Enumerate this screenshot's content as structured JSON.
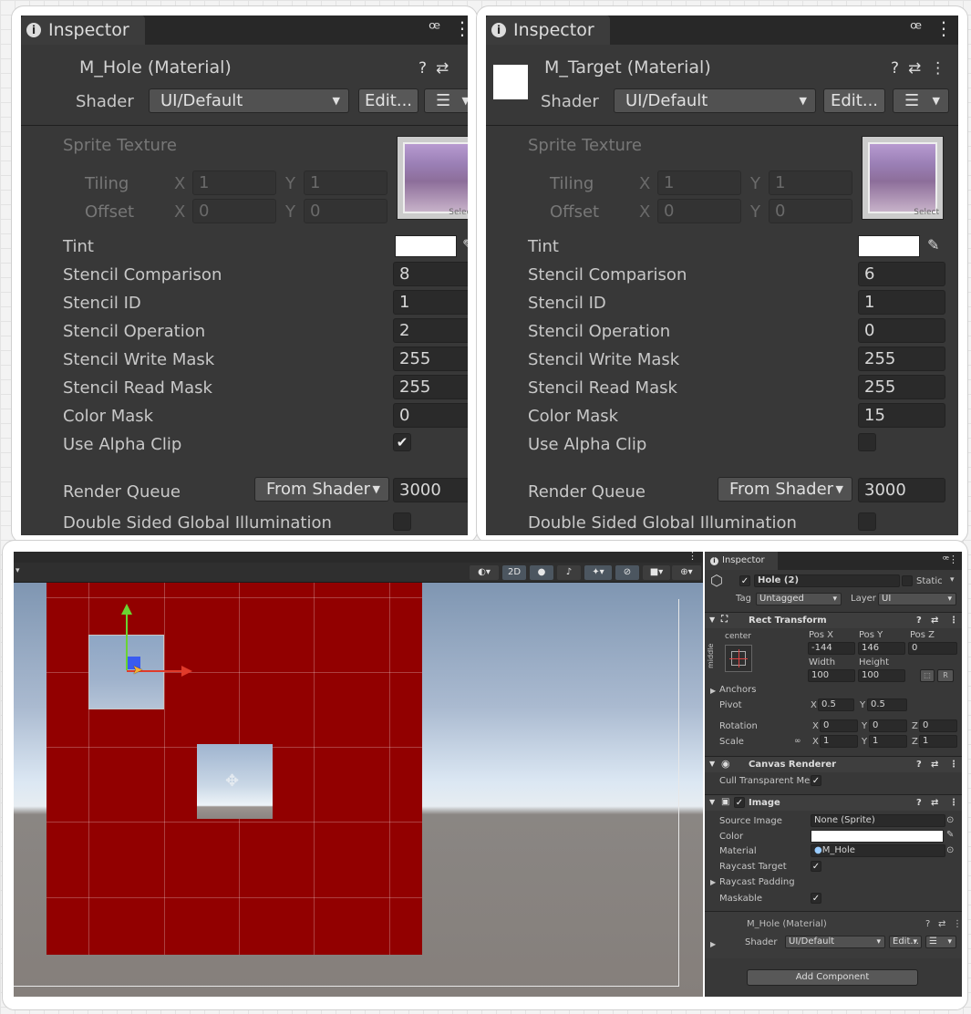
{
  "left_inspector": {
    "tab_title": "Inspector",
    "material_name": "M_Hole (Material)",
    "shader_label": "Shader",
    "shader_value": "UI/Default",
    "edit_label": "Edit...",
    "sprite_texture_label": "Sprite Texture",
    "tiling_label": "Tiling",
    "offset_label": "Offset",
    "x_label": "X",
    "y_label": "Y",
    "tiling_x": "1",
    "tiling_y": "1",
    "offset_x": "0",
    "offset_y": "0",
    "thumb_caption": "Select",
    "tint_label": "Tint",
    "tint_color": "#ffffff",
    "props": [
      {
        "label": "Stencil Comparison",
        "value": "8"
      },
      {
        "label": "Stencil ID",
        "value": "1"
      },
      {
        "label": "Stencil Operation",
        "value": "2"
      },
      {
        "label": "Stencil Write Mask",
        "value": "255"
      },
      {
        "label": "Stencil Read Mask",
        "value": "255"
      },
      {
        "label": "Color Mask",
        "value": "0"
      }
    ],
    "alpha_clip_label": "Use Alpha Clip",
    "alpha_clip_checked": true,
    "alpha_clip_mark": "✔",
    "render_queue_label": "Render Queue",
    "render_queue_mode": "From Shader",
    "render_queue_value": "3000",
    "dsgi_label": "Double Sided Global Illumination"
  },
  "right_inspector": {
    "tab_title": "Inspector",
    "material_name": "M_Target (Material)",
    "shader_label": "Shader",
    "shader_value": "UI/Default",
    "edit_label": "Edit...",
    "sprite_texture_label": "Sprite Texture",
    "tiling_label": "Tiling",
    "offset_label": "Offset",
    "x_label": "X",
    "y_label": "Y",
    "tiling_x": "1",
    "tiling_y": "1",
    "offset_x": "0",
    "offset_y": "0",
    "thumb_caption": "Select",
    "tint_label": "Tint",
    "tint_color": "#ffffff",
    "props": [
      {
        "label": "Stencil Comparison",
        "value": "6"
      },
      {
        "label": "Stencil ID",
        "value": "1"
      },
      {
        "label": "Stencil Operation",
        "value": "0"
      },
      {
        "label": "Stencil Write Mask",
        "value": "255"
      },
      {
        "label": "Stencil Read Mask",
        "value": "255"
      },
      {
        "label": "Color Mask",
        "value": "15"
      }
    ],
    "alpha_clip_label": "Use Alpha Clip",
    "alpha_clip_checked": false,
    "alpha_clip_mark": "",
    "render_queue_label": "Render Queue",
    "render_queue_mode": "From Shader",
    "render_queue_value": "3000",
    "dsgi_label": "Double Sided Global Illumination"
  },
  "scene": {
    "toolbar_2d": "2D",
    "red_panel_color": "#920000"
  },
  "small_inspector": {
    "tab_title": "Inspector",
    "object_name": "Hole (2)",
    "static_label": "Static",
    "tag_label": "Tag",
    "tag_value": "Untagged",
    "layer_label": "Layer",
    "layer_value": "UI",
    "rect_transform": {
      "title": "Rect Transform",
      "anchor_preset_h": "center",
      "anchor_preset_v": "middle",
      "pos_x_label": "Pos X",
      "pos_y_label": "Pos Y",
      "pos_z_label": "Pos Z",
      "pos_x": "-144",
      "pos_y": "146",
      "pos_z": "0",
      "width_label": "Width",
      "height_label": "Height",
      "width": "100",
      "height": "100",
      "r_label": "R",
      "anchors_label": "Anchors",
      "pivot_label": "Pivot",
      "pivot_x": "0.5",
      "pivot_y": "0.5",
      "rotation_label": "Rotation",
      "rot_x": "0",
      "rot_y": "0",
      "rot_z": "0",
      "scale_label": "Scale",
      "scale_x": "1",
      "scale_y": "1",
      "scale_z": "1",
      "x": "X",
      "y": "Y",
      "z": "Z"
    },
    "canvas_renderer": {
      "title": "Canvas Renderer",
      "cull_label": "Cull Transparent Mes"
    },
    "image": {
      "title": "Image",
      "source_label": "Source Image",
      "source_value": "None (Sprite)",
      "color_label": "Color",
      "material_label": "Material",
      "material_value": "M_Hole",
      "raycast_target_label": "Raycast Target",
      "raycast_padding_label": "Raycast Padding",
      "maskable_label": "Maskable"
    },
    "material_preview": {
      "name": "M_Hole (Material)",
      "shader_label": "Shader",
      "shader_value": "UI/Default",
      "edit_label": "Edit..."
    },
    "add_component_label": "Add Component"
  }
}
